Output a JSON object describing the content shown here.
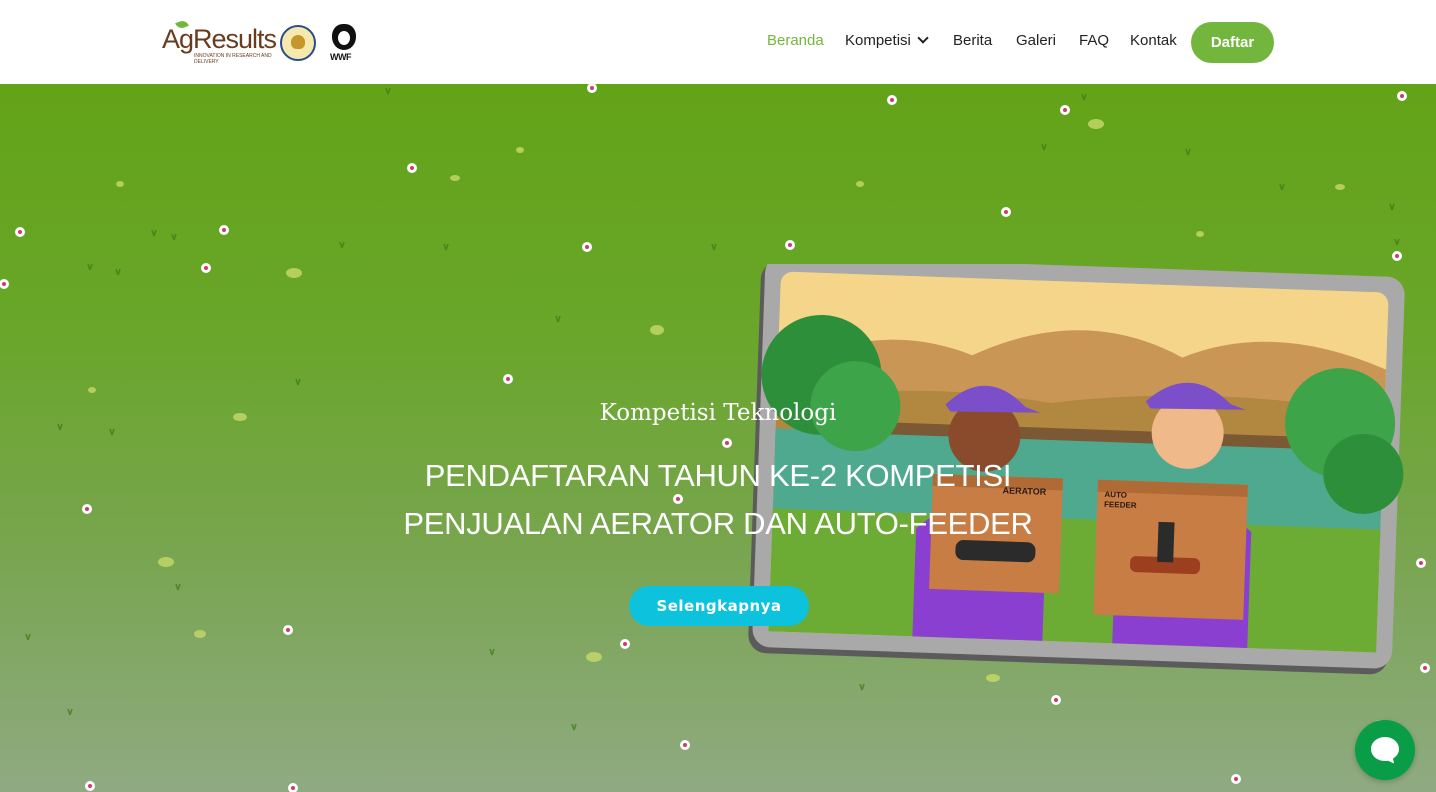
{
  "brand": {
    "logo_main": "AgResults",
    "logo_tagline": "Innovation in research and delivery",
    "logo_partner_2": "WWF"
  },
  "nav": {
    "items": [
      {
        "label": "Beranda",
        "active": true
      },
      {
        "label": "Kompetisi",
        "has_dropdown": true
      },
      {
        "label": "Berita"
      },
      {
        "label": "Galeri"
      },
      {
        "label": "FAQ"
      },
      {
        "label": "Kontak"
      }
    ],
    "cta_label": "Daftar"
  },
  "hero": {
    "subtitle": "Kompetisi Teknologi",
    "title": "PENDAFTARAN TAHUN KE-2 KOMPETISI\nPENJUALAN AERATOR DAN AUTO-FEEDER",
    "button_label": "Selengkapnya",
    "illustration": {
      "box_left_label": "AERATOR",
      "box_right_label": "AUTO\nFEEDER"
    }
  },
  "chat": {
    "icon": "chat-icon"
  },
  "colors": {
    "accent": "#73b63d",
    "cta": "#0cc2dc",
    "chat": "#0a9d48",
    "hero_top": "#63a318",
    "hero_bottom": "#8faa82"
  }
}
